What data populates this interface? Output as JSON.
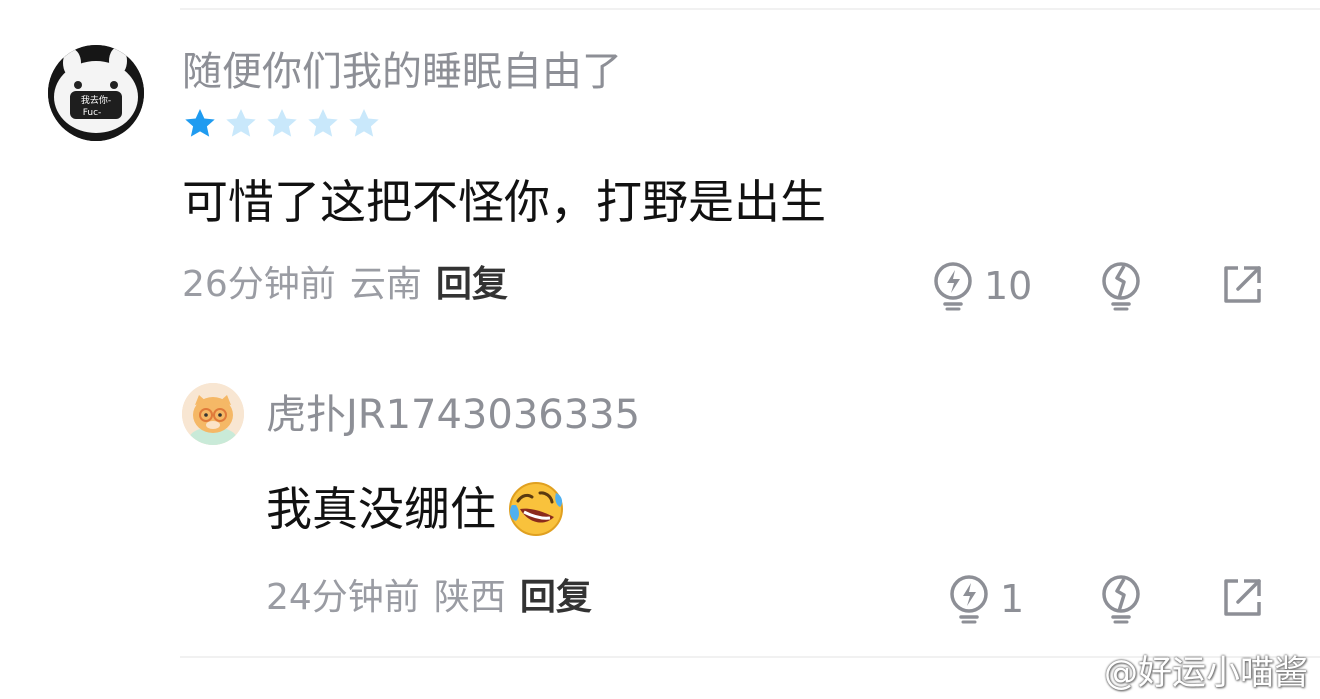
{
  "comment": {
    "username": "随便你们我的睡眠自由了",
    "avatar_text_line1": "我去你-",
    "avatar_text_line2": "Fuc-",
    "rating": 1,
    "rating_max": 5,
    "text": "可惜了这把不怪你，打野是出生",
    "time": "26分钟前",
    "location": "云南",
    "reply_label": "回复",
    "like_count": "10"
  },
  "reply": {
    "username": "虎扑JR1743036335",
    "text": "我真没绷住",
    "time": "24分钟前",
    "location": "陕西",
    "reply_label": "回复",
    "like_count": "1"
  },
  "watermark": {
    "text": "@好运小喵酱"
  },
  "colors": {
    "star_filled": "#1f9bf0",
    "star_empty": "#c9e8fb",
    "muted": "#8d8f96",
    "text": "#111111"
  },
  "icons": {
    "like": "lightning-bulb-icon",
    "dislike": "cracked-bulb-icon",
    "share": "share-arrow-icon",
    "emoji": "laughing-crying-emoji-icon"
  }
}
